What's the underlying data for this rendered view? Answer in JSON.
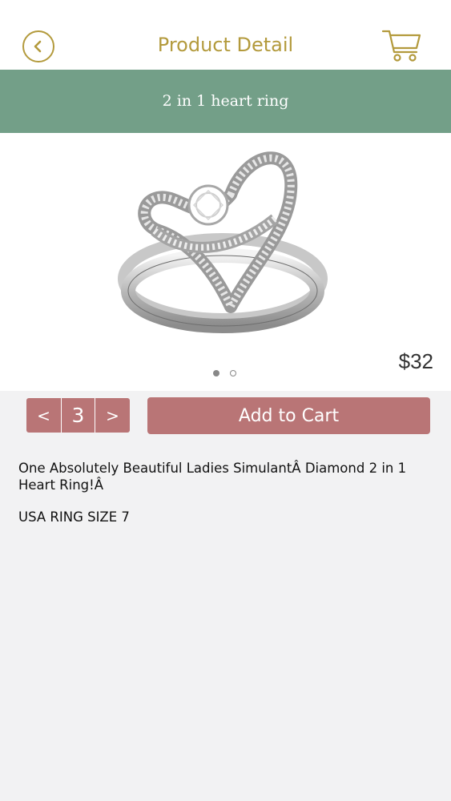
{
  "header": {
    "title": "Product Detail",
    "back_icon": "chevron-left-circle-icon",
    "cart_icon": "shopping-cart-icon"
  },
  "product": {
    "name": "2 in 1 heart ring",
    "price": "$32",
    "image_icon": "heart-ring-image",
    "gallery": {
      "total_images": 2,
      "current_index": 0
    },
    "description": [
      "One Absolutely Beautiful Ladies SimulantÂ Diamond 2 in 1 Heart Ring!Â",
      "USA RING SIZE 7"
    ]
  },
  "quantity": {
    "decrement_label": "<",
    "value": "3",
    "increment_label": ">"
  },
  "actions": {
    "add_to_cart_label": "Add to Cart"
  },
  "colors": {
    "accent_gold": "#b39a3c",
    "banner_green": "#739f88",
    "button_rose": "#b97576",
    "background": "#f2f2f3"
  }
}
